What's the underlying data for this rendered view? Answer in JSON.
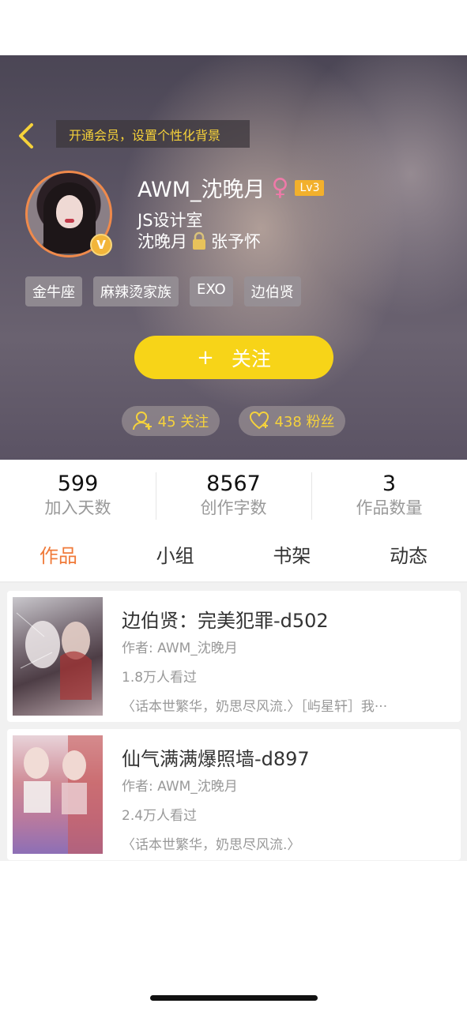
{
  "header": {
    "vip_banner": "开通会员，设置个性化背景",
    "username": "AWM_沈晚月",
    "gender_symbol": "♀",
    "level": "Lv3",
    "studio": "JS设计室",
    "couple_left": "沈晚月",
    "couple_right": "张予怀",
    "avatar_badge": "V",
    "tags": [
      "金牛座",
      "麻辣烫家族",
      "EXO",
      "边伯贤"
    ],
    "follow_plus": "+",
    "follow_label": "关注",
    "following_label": "45 关注",
    "fans_label": "438 粉丝"
  },
  "stats": [
    {
      "value": "599",
      "label": "加入天数"
    },
    {
      "value": "8567",
      "label": "创作字数"
    },
    {
      "value": "3",
      "label": "作品数量"
    }
  ],
  "tabs": [
    "作品",
    "小组",
    "书架",
    "动态"
  ],
  "works": [
    {
      "title": "边伯贤：完美犯罪-d502",
      "author": "作者: AWM_沈晚月",
      "views": "1.8万人看过",
      "desc": "〈话本世繁华，奶思尽风流.〉［屿星轩］我···"
    },
    {
      "title": "仙气满满爆照墙-d897",
      "author": "作者: AWM_沈晚月",
      "views": "2.4万人看过",
      "desc": "〈话本世繁华，奶思尽风流.〉"
    }
  ],
  "colors": {
    "accent_orange": "#f07a3a",
    "follow_yellow": "#f7d418",
    "banner_yellow": "#f6d23a"
  }
}
